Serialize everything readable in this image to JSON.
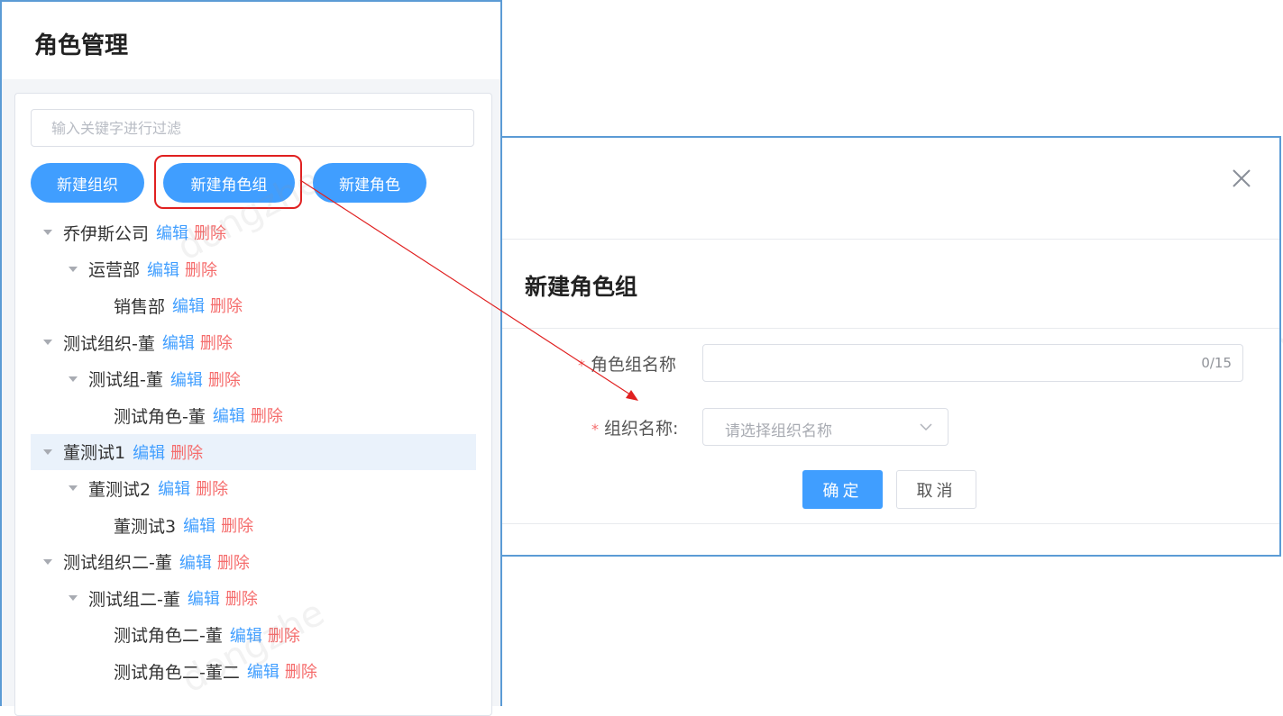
{
  "page": {
    "title": "角色管理"
  },
  "search": {
    "placeholder": "输入关键字进行过滤"
  },
  "toolbar": {
    "new_org_label": "新建组织",
    "new_role_group_label": "新建角色组",
    "new_role_label": "新建角色"
  },
  "tree": {
    "edit_label": "编辑",
    "delete_label": "删除",
    "nodes": [
      {
        "label": "乔伊斯公司",
        "level": 0,
        "expanded": true
      },
      {
        "label": "运营部",
        "level": 1,
        "expanded": true
      },
      {
        "label": "销售部",
        "level": 2,
        "expanded": null
      },
      {
        "label": "测试组织-董",
        "level": 0,
        "expanded": true
      },
      {
        "label": "测试组-董",
        "level": 1,
        "expanded": true
      },
      {
        "label": "测试角色-董",
        "level": 2,
        "expanded": null
      },
      {
        "label": "董测试1",
        "level": 0,
        "expanded": true,
        "selected": true
      },
      {
        "label": "董测试2",
        "level": 1,
        "expanded": true
      },
      {
        "label": "董测试3",
        "level": 2,
        "expanded": null
      },
      {
        "label": "测试组织二-董",
        "level": 0,
        "expanded": true
      },
      {
        "label": "测试组二-董",
        "level": 1,
        "expanded": true
      },
      {
        "label": "测试角色二-董",
        "level": 2,
        "expanded": null
      },
      {
        "label": "测试角色二-董二",
        "level": 2,
        "expanded": null
      }
    ]
  },
  "watermark": {
    "text": "dongzhe"
  },
  "dialog": {
    "title": "新建角色组",
    "fields": {
      "role_group_name": {
        "label": "角色组名称",
        "required_mark": "*",
        "value": "",
        "counter": "0/15"
      },
      "org_name": {
        "label": "组织名称:",
        "required_mark": "*",
        "placeholder": "请选择组织名称"
      }
    },
    "confirm_label": "确定",
    "cancel_label": "取消"
  },
  "colors": {
    "accent": "#409eff",
    "danger": "#f56c6c",
    "annotation": "#e02020",
    "frame": "#5b9bd5"
  }
}
